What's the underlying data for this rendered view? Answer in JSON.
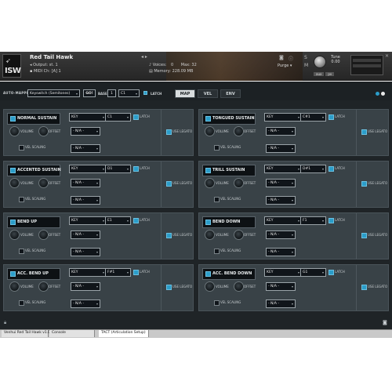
{
  "header": {
    "instrument_name": "Red Tail Hawk",
    "output_label": "Output:",
    "output_value": "st. 1",
    "midi_label": "MIDI Ch:",
    "midi_value": "[A] 1",
    "voices_label": "Voices:",
    "voices_value": "0",
    "max_label": "Max:",
    "max_value": "32",
    "memory_label": "Memory:",
    "memory_value": "228.09 MB",
    "purge_label": "Purge",
    "tune_label": "Tune",
    "tune_value": "0.00",
    "aux_label": "aux",
    "pv_label": "pv",
    "logo_text": "ISW"
  },
  "topbar": {
    "auto_mapping_label": "AUTO-MAPPING",
    "mode_value": "Keyswitch (Semitones)",
    "go_label": "GO!",
    "base_label": "BASE",
    "base_value": "1",
    "base_note": "C1",
    "latch_label": "LATCH",
    "tabs": [
      {
        "label": "MAP",
        "active": true
      },
      {
        "label": "VEL",
        "active": false
      },
      {
        "label": "ENV",
        "active": false
      }
    ],
    "dot_colors": [
      "#2b9dc9",
      "#e8e8e8"
    ]
  },
  "labels": {
    "volume": "VOLUME",
    "offset": "OFFSET",
    "vel_scaling": "VEL SCALING",
    "latch": "LATCH",
    "use_legato": "USE LEGATO",
    "na": "- N/A -"
  },
  "articulations": [
    {
      "name": "NORMAL SUSTAIN",
      "type": "KEY",
      "note": "C1"
    },
    {
      "name": "TONGUED SUSTAIN",
      "type": "KEY",
      "note": "C#1"
    },
    {
      "name": "ACCENTED SUSTAIN",
      "type": "KEY",
      "note": "D1"
    },
    {
      "name": "TRILL SUSTAIN",
      "type": "KEY",
      "note": "D#1"
    },
    {
      "name": "BEND UP",
      "type": "KEY",
      "note": "E1"
    },
    {
      "name": "BEND DOWN",
      "type": "KEY",
      "note": "F1"
    },
    {
      "name": "ACC. BEND UP",
      "type": "KEY",
      "note": "F#1"
    },
    {
      "name": "ACC. BEND DOWN",
      "type": "KEY",
      "note": "G1"
    }
  ],
  "bottom_tabs": [
    {
      "label": "Venhui Red Tail Hawk v1.0",
      "active": false
    },
    {
      "label": "Console",
      "active": false
    },
    {
      "label": "TACT (Articulation Setup)",
      "active": true
    }
  ],
  "colors": {
    "accent": "#2b9dc9",
    "panel": "#1f2427",
    "card": "#394247"
  }
}
